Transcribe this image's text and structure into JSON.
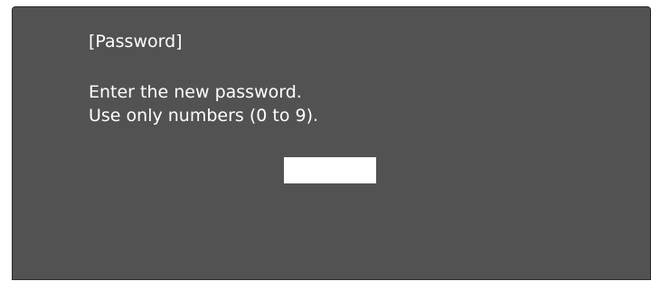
{
  "dialog": {
    "title": "[Password]",
    "message_line_1": "Enter the new password.",
    "message_line_2": "Use only numbers (0 to 9).",
    "password_input": {
      "value": "",
      "placeholder": ""
    }
  },
  "colors": {
    "dialog_background": "#525252",
    "text": "#ffffff",
    "input_background": "#ffffff"
  }
}
